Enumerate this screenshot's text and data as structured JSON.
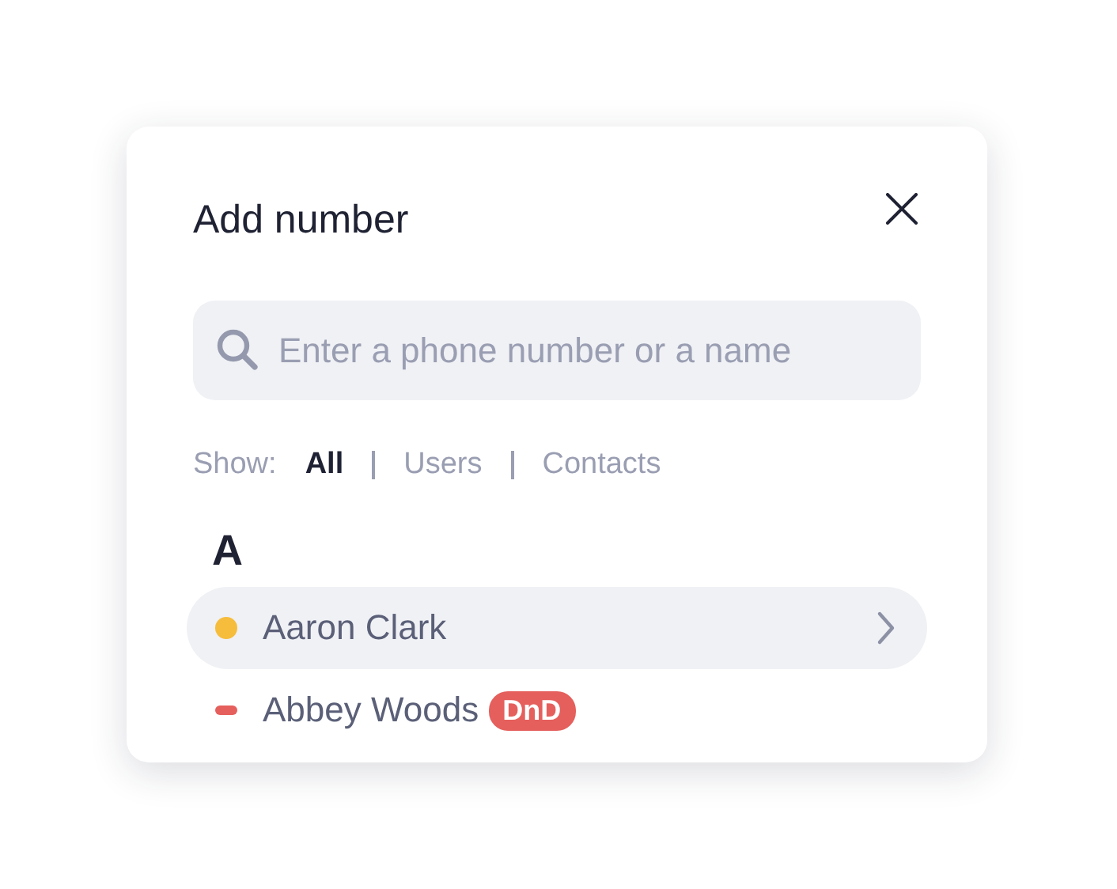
{
  "dialog": {
    "title": "Add number"
  },
  "search": {
    "placeholder": "Enter a phone number or a name"
  },
  "filter": {
    "label": "Show:",
    "options": [
      {
        "label": "All",
        "selected": true
      },
      {
        "label": "Users",
        "selected": false
      },
      {
        "label": "Contacts",
        "selected": false
      }
    ]
  },
  "groups": [
    {
      "letter": "A",
      "contacts": [
        {
          "name": "Aaron Clark",
          "kind": "dot",
          "color": "#f6bd3c",
          "selected": true
        },
        {
          "name": "Abbey Woods",
          "kind": "dash",
          "color": "#e55f5c",
          "selected": false,
          "badge": "DnD"
        }
      ]
    }
  ]
}
